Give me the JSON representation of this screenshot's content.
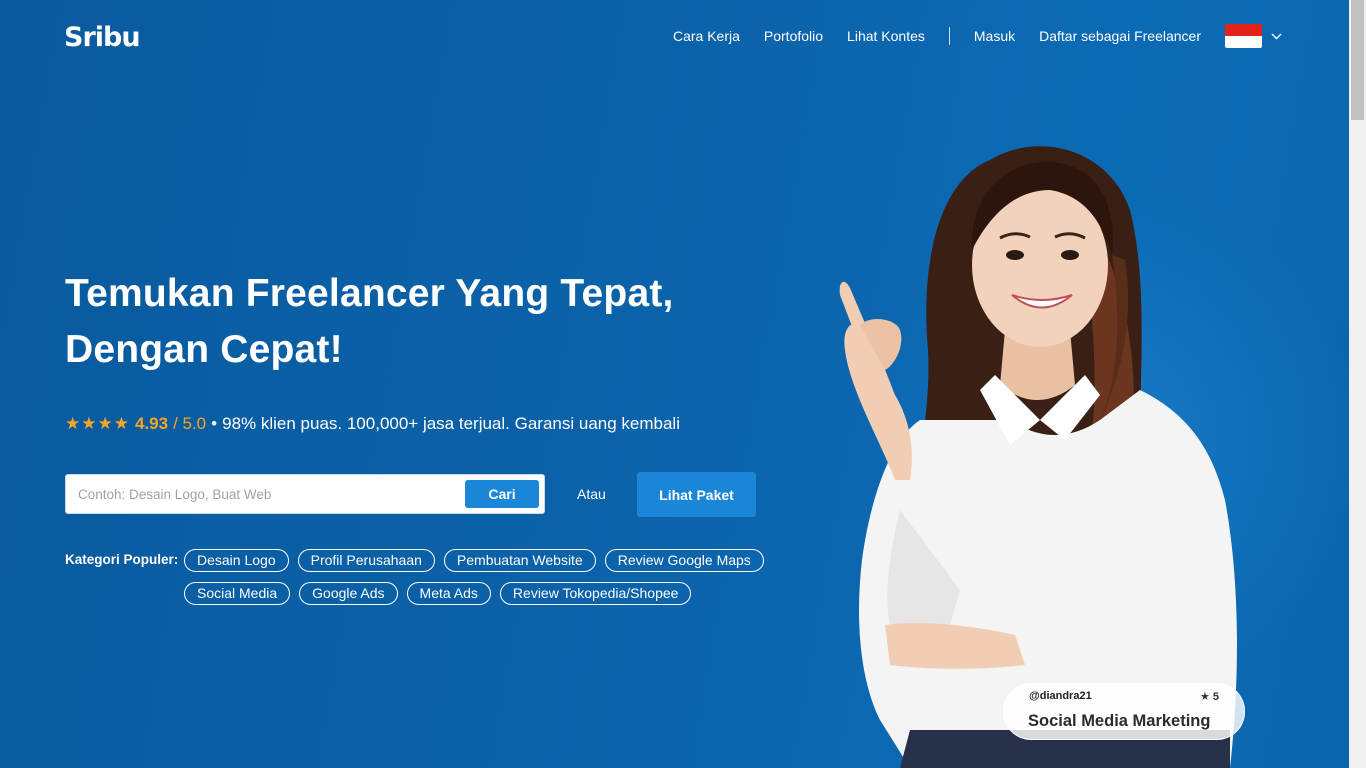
{
  "brand": {
    "logo_text": "Sribu"
  },
  "nav": {
    "items": [
      "Cara Kerja",
      "Portofolio",
      "Lihat Kontes"
    ],
    "login": "Masuk",
    "register": "Daftar sebagai Freelancer",
    "language_flag": "indonesia-flag-icon"
  },
  "hero": {
    "headline_line1": "Temukan Freelancer Yang Tepat,",
    "headline_line2": "Dengan Cepat!",
    "stars": "★★★★",
    "rating": "4.93",
    "rating_max": "/ 5.0",
    "bullet": "•",
    "tagline": "98% klien puas. 100,000+ jasa terjual. Garansi uang kembali"
  },
  "search": {
    "placeholder": "Contoh: Desain Logo, Buat Web",
    "value": "",
    "button": "Cari",
    "or_text": "Atau",
    "package_button": "Lihat Paket"
  },
  "categories": {
    "label": "Kategori Populer:",
    "items": [
      "Desain Logo",
      "Profil Perusahaan",
      "Pembuatan Website",
      "Review Google Maps",
      "Social Media",
      "Google Ads",
      "Meta Ads",
      "Review Tokopedia/Shopee"
    ]
  },
  "card": {
    "username": "@diandra21",
    "rating": "★ 5",
    "service": "Social Media Marketing"
  },
  "colors": {
    "background": "#0b62a9",
    "accent_button": "#1a86d8",
    "star": "#f5a623"
  }
}
